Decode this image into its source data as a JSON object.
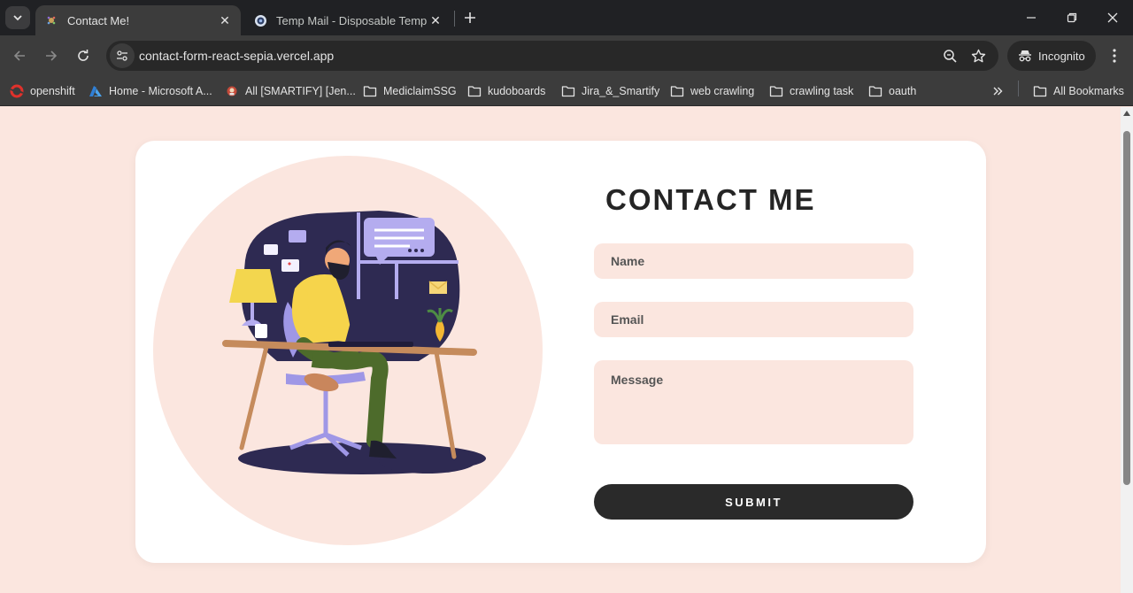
{
  "browser": {
    "tabs": [
      {
        "title": "Contact Me!",
        "active": true
      },
      {
        "title": "Temp Mail - Disposable Tempor",
        "active": false
      }
    ],
    "url": "contact-form-react-sepia.vercel.app",
    "profile_label": "Incognito",
    "bookmarks": [
      {
        "label": "openshift",
        "icon": "openshift-icon"
      },
      {
        "label": "Home - Microsoft A...",
        "icon": "azure-icon"
      },
      {
        "label": "All [SMARTIFY] [Jen...",
        "icon": "jenkins-icon"
      },
      {
        "label": "MediclaimSSG",
        "icon": "folder-icon"
      },
      {
        "label": "kudoboards",
        "icon": "folder-icon"
      },
      {
        "label": "Jira_&_Smartify",
        "icon": "folder-icon"
      },
      {
        "label": "web crawling",
        "icon": "folder-icon"
      },
      {
        "label": "crawling task",
        "icon": "folder-icon"
      },
      {
        "label": "oauth",
        "icon": "folder-icon"
      }
    ],
    "all_bookmarks_label": "All Bookmarks"
  },
  "page": {
    "heading": "CONTACT ME",
    "form": {
      "name_placeholder": "Name",
      "email_placeholder": "Email",
      "message_placeholder": "Message",
      "submit_label": "SUBMIT"
    }
  },
  "colors": {
    "page_background": "#fbe6df",
    "card_background": "#ffffff",
    "field_background": "#fbe6df",
    "button_background": "#2a2a2a",
    "heading_color": "#252525"
  }
}
